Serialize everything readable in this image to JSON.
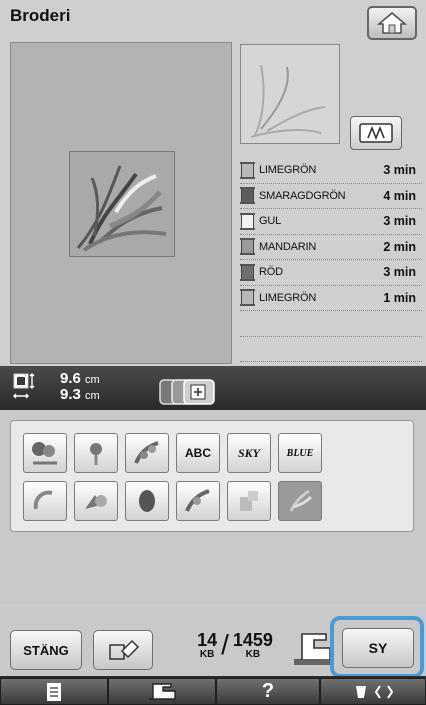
{
  "header": {
    "title": "Broderi"
  },
  "colors": [
    {
      "name": "LIMEGRÖN",
      "time": "3 min",
      "color": "#b9b9b9"
    },
    {
      "name": "SMARAGDGRÖN",
      "time": "4 min",
      "color": "#6e6e6e"
    },
    {
      "name": "GUL",
      "time": "3 min",
      "color": "#ececec"
    },
    {
      "name": "MANDARIN",
      "time": "2 min",
      "color": "#9a9a9a"
    },
    {
      "name": "RÖD",
      "time": "3 min",
      "color": "#7a7a7a"
    },
    {
      "name": "LIMEGRÖN",
      "time": "1 min",
      "color": "#b9b9b9"
    }
  ],
  "size": {
    "width": "9.6",
    "height": "9.3",
    "unit": "cm"
  },
  "patterns": [
    {
      "label": "",
      "icon": "flower-pattern-icon"
    },
    {
      "label": "",
      "icon": "floral-pattern-icon"
    },
    {
      "label": "",
      "icon": "leaf-pattern-icon"
    },
    {
      "label": "ABC",
      "icon": "abc-text-pattern-icon"
    },
    {
      "label": "SKY",
      "icon": "sky-text-pattern-icon"
    },
    {
      "label": "BLUE",
      "icon": "blue-text-pattern-icon"
    },
    {
      "label": "",
      "icon": "wreath-pattern-icon"
    },
    {
      "label": "",
      "icon": "rose-pattern-icon"
    },
    {
      "label": "",
      "icon": "oval-pattern-icon"
    },
    {
      "label": "",
      "icon": "leaf-pattern-2-icon"
    },
    {
      "label": "",
      "icon": "shape-pattern-icon"
    },
    {
      "label": "",
      "icon": "selected-pattern-icon"
    }
  ],
  "buttons": {
    "close": "STÄNG",
    "sew": "SY"
  },
  "memory": {
    "used": "14",
    "total": "1459",
    "unit": "KB"
  },
  "tabs": {
    "help": "?"
  }
}
